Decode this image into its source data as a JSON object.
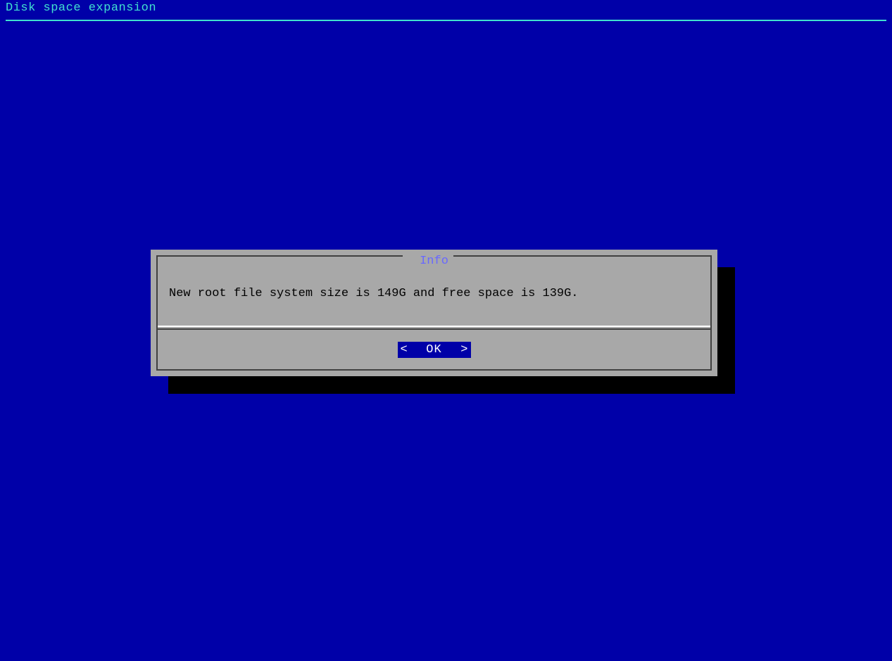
{
  "header": {
    "title": "Disk space expansion"
  },
  "dialog": {
    "title": "Info",
    "message": "New root file system size is 149G and free space is 139G.",
    "bracket_left": "<",
    "bracket_right": ">",
    "ok_label": "OK"
  }
}
